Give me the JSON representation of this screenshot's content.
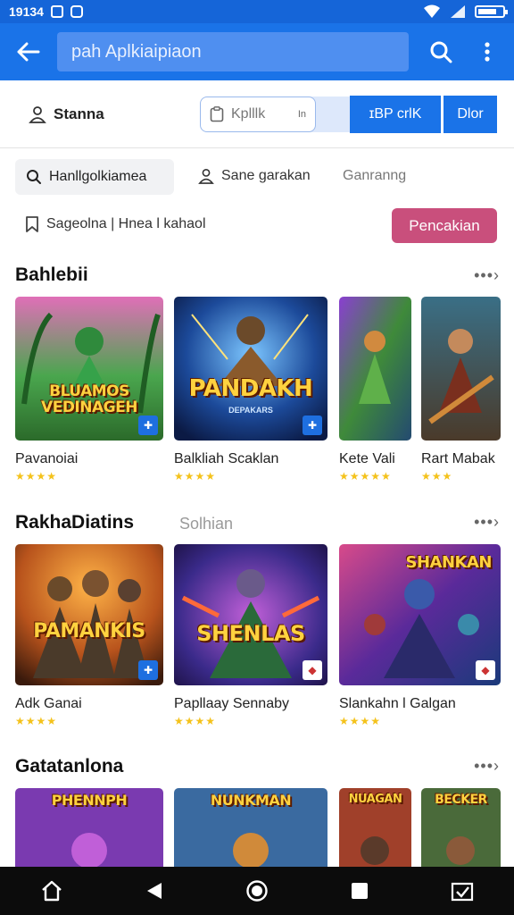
{
  "status_bar": {
    "time": "19134"
  },
  "app_bar": {
    "search_placeholder": "pah Aplkiaipiaon",
    "back_icon": "arrow-back-icon",
    "search_icon": "search-icon",
    "more_icon": "more-vert-icon"
  },
  "filters": {
    "user_label": "Stanna",
    "app_chip_label": "Kplllk",
    "app_chip_sub": "In",
    "btn_primary": "ɪΒP crlK",
    "btn_secondary": "Dlor",
    "tab_active": "Hanllgolkiamea",
    "tab_2": "Sane garakan",
    "tab_3": "Ganranng",
    "tab_4": "Sageolna | Hnea l kahaol",
    "search_button": "Pencakian"
  },
  "sections": [
    {
      "title": "Bahlebii",
      "subtitle": "",
      "items": [
        {
          "name": "Pavanoiai",
          "stars": "★★★★",
          "art": "BLUAMOS VEDINAGEH"
        },
        {
          "name": "Balkliah Scaklan",
          "stars": "★★★★",
          "art": "PANDAKH"
        },
        {
          "name": "Kete Vali",
          "stars": "★★★★★",
          "art": ""
        },
        {
          "name": "Rart Mabak",
          "stars": "★★★",
          "art": ""
        }
      ]
    },
    {
      "title": "RakhaDiatins",
      "subtitle": "Solhian",
      "items": [
        {
          "name": "Adk Ganai",
          "stars": "★★★★",
          "art": "PAMANKIS"
        },
        {
          "name": "Papllaay Sennaby",
          "stars": "★★★★",
          "art": "SHENLAS"
        },
        {
          "name": "Slankahn l Galgan",
          "stars": "★★★★",
          "art": "SHANKAN"
        }
      ]
    },
    {
      "title": "Gatatanlona",
      "subtitle": "",
      "items": [
        {
          "name": "",
          "stars": "",
          "art": "PHENNPH"
        },
        {
          "name": "",
          "stars": "",
          "art": "NUNKMAN"
        },
        {
          "name": "",
          "stars": "",
          "art": "NUAGAN"
        },
        {
          "name": "",
          "stars": "",
          "art": "BECKER"
        }
      ]
    }
  ],
  "more_label": "•••›",
  "colors": {
    "app_bar": "#1a73e8",
    "accent_pink": "#c94f7c",
    "stars": "#f4c21b"
  }
}
